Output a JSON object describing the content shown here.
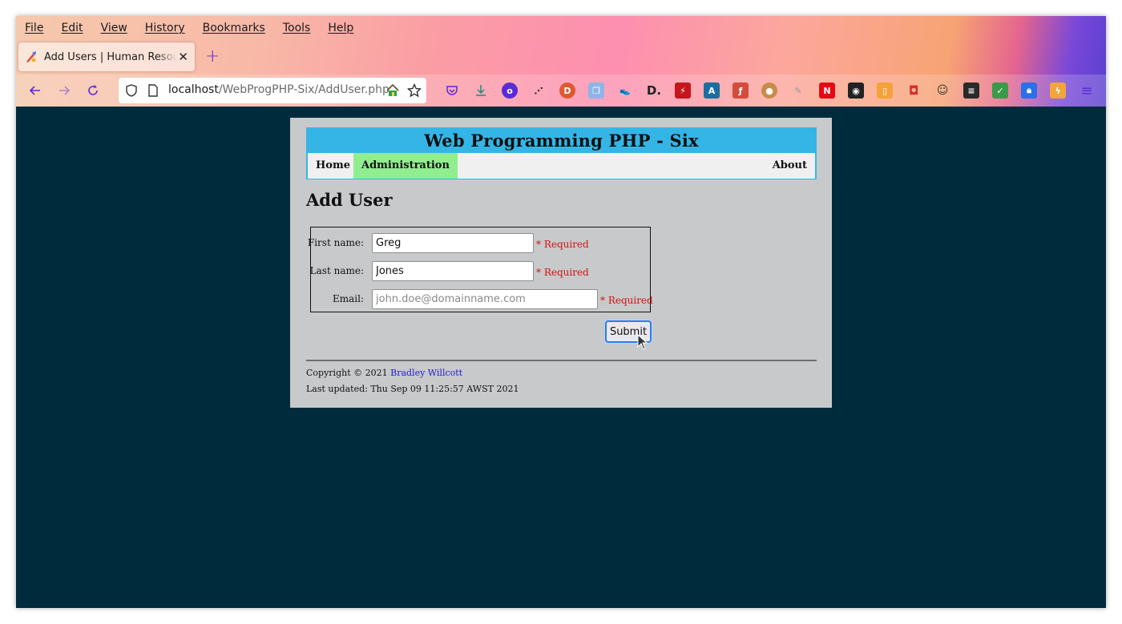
{
  "browser": {
    "menu": [
      "File",
      "Edit",
      "View",
      "History",
      "Bookmarks",
      "Tools",
      "Help"
    ],
    "tab": {
      "title": "Add Users | Human Resources"
    },
    "url": {
      "host": "localhost",
      "path": "/WebProgPHP-Six/AddUser.php"
    }
  },
  "site": {
    "title": "Web Programming PHP - Six",
    "nav": {
      "home": "Home",
      "administration": "Administration",
      "about": "About"
    },
    "heading": "Add User"
  },
  "form": {
    "first_name": {
      "label": "First name:",
      "value": "Greg",
      "required": "* Required"
    },
    "last_name": {
      "label": "Last name:",
      "value": "Jones",
      "required": "* Required"
    },
    "email": {
      "label": "Email:",
      "value": "",
      "placeholder": "john.doe@domainname.com",
      "required": "* Required"
    },
    "submit": "Submit"
  },
  "footer": {
    "copyright": "Copyright © 2021",
    "author": "Bradley Willcott",
    "updated": "Last updated: Thu Sep 09 11:25:57 AWST 2021"
  },
  "colors": {
    "page_bg": "#002b3d",
    "container_bg": "#c8c9ca",
    "header_accent": "#35b5e5",
    "active_nav": "#90ee90",
    "required": "#d41010",
    "link": "#1c1cd6"
  }
}
